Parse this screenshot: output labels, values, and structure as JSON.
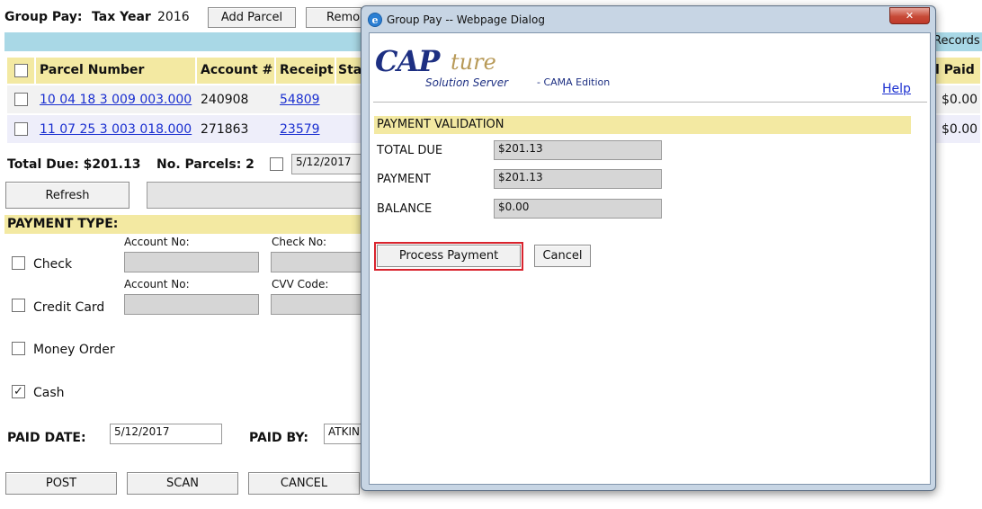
{
  "page": {
    "title": "Group Pay:",
    "tax_year_label": "Tax Year",
    "tax_year": "2016",
    "add_parcel": "Add Parcel",
    "remove": "Remo",
    "records": "Records"
  },
  "table": {
    "columns": [
      "Parcel Number",
      "Account #",
      "Receipt",
      "Sta",
      "l Paid"
    ],
    "rows": [
      {
        "parcel": "10 04 18 3 009 003.000",
        "account": "240908",
        "receipt": "54809",
        "paid": "$0.00"
      },
      {
        "parcel": "11 07 25 3 003 018.000",
        "account": "271863",
        "receipt": "23579",
        "paid": "$0.00"
      }
    ]
  },
  "summary": {
    "total_due": "Total Due: $201.13",
    "no_parcels": "No. Parcels: 2",
    "date": "5/12/2017",
    "refresh": "Refresh"
  },
  "payment_type": {
    "header": "PAYMENT TYPE:",
    "check": "Check",
    "credit_card": "Credit Card",
    "money_order": "Money Order",
    "cash": "Cash",
    "account_no": "Account No:",
    "check_no": "Check No:",
    "cvv_code": "CVV Code:",
    "cash_checked_glyph": "✓"
  },
  "paid": {
    "paid_date_label": "PAID DATE:",
    "paid_date": "5/12/2017",
    "paid_by_label": "PAID BY:",
    "paid_by": "ATKIN"
  },
  "actions": {
    "post": "POST",
    "scan": "SCAN",
    "cancel": "CANCEL"
  },
  "dialog": {
    "title": "Group Pay -- Webpage Dialog",
    "logo_main": "CAP",
    "logo_script": "ture",
    "logo_sub": "Solution Server",
    "logo_edition": " - CAMA Edition",
    "help": "Help",
    "section": "PAYMENT VALIDATION",
    "total_due_label": "TOTAL DUE",
    "total_due": "$201.13",
    "payment_label": "PAYMENT",
    "payment": "$201.13",
    "balance_label": "BALANCE",
    "balance": "$0.00",
    "process_payment": "Process Payment",
    "cancel": "Cancel",
    "close_glyph": "✕"
  },
  "colors": {
    "accent_blue_bar": "#a9d8e6",
    "yellow_header": "#f3e9a2",
    "link": "#1a2fd0",
    "highlight_red": "#d9232d"
  }
}
